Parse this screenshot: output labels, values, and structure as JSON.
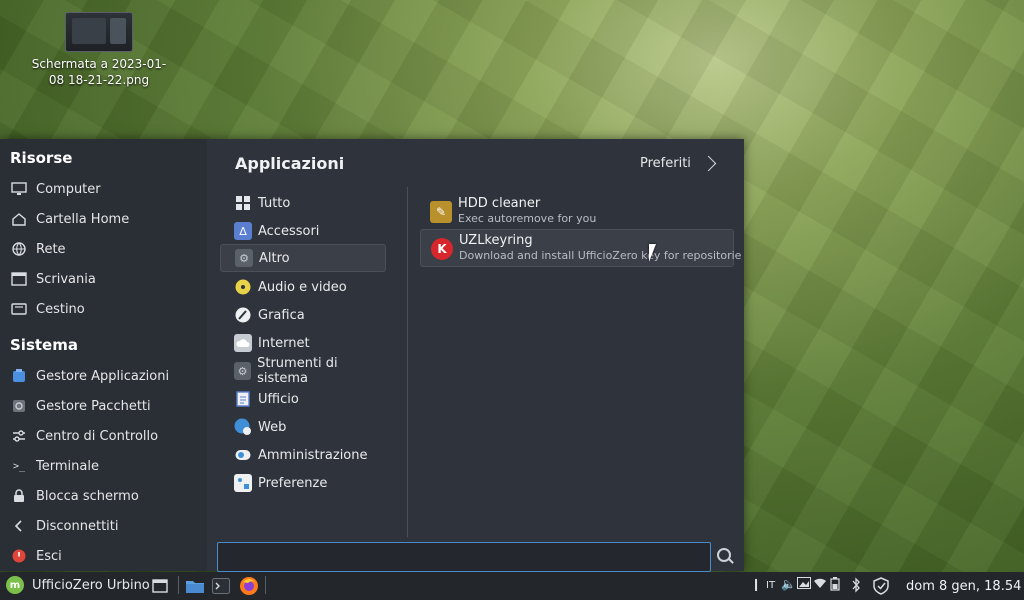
{
  "desktop": {
    "file_label": "Schermata a 2023-01-\n08 18-21-22.png"
  },
  "menu": {
    "resources_title": "Risorse",
    "resources": [
      {
        "label": "Computer",
        "icon": "monitor-icon"
      },
      {
        "label": "Cartella Home",
        "icon": "home-icon"
      },
      {
        "label": "Rete",
        "icon": "network-icon"
      },
      {
        "label": "Scrivania",
        "icon": "desktop-icon"
      },
      {
        "label": "Cestino",
        "icon": "trash-icon"
      }
    ],
    "system_title": "Sistema",
    "system": [
      {
        "label": "Gestore Applicazioni",
        "icon": "software-manager-icon"
      },
      {
        "label": "Gestore Pacchetti",
        "icon": "package-icon"
      },
      {
        "label": "Centro di Controllo",
        "icon": "sliders-icon"
      },
      {
        "label": "Terminale",
        "icon": "terminal-icon"
      },
      {
        "label": "Blocca schermo",
        "icon": "lock-icon"
      },
      {
        "label": "Disconnettiti",
        "icon": "chevron-left-icon"
      },
      {
        "label": "Esci",
        "icon": "power-icon"
      }
    ],
    "apps_title": "Applicazioni",
    "favorites_label": "Preferiti",
    "categories": [
      {
        "label": "Tutto",
        "icon": "grid-icon"
      },
      {
        "label": "Accessori",
        "icon": "accessories-icon"
      },
      {
        "label": "Altro",
        "icon": "gear-icon"
      },
      {
        "label": "Audio e video",
        "icon": "disc-icon"
      },
      {
        "label": "Grafica",
        "icon": "paint-icon"
      },
      {
        "label": "Internet",
        "icon": "cloud-icon"
      },
      {
        "label": "Strumenti di sistema",
        "icon": "gear-icon"
      },
      {
        "label": "Ufficio",
        "icon": "document-icon"
      },
      {
        "label": "Web",
        "icon": "globe-icon"
      },
      {
        "label": "Amministrazione",
        "icon": "toggle-icon"
      },
      {
        "label": "Preferenze",
        "icon": "preferences-icon"
      }
    ],
    "selected_category": "Altro",
    "apps": [
      {
        "name": "HDD cleaner",
        "desc": "Exec autoremove for you",
        "icon": "hdd-cleaner-icon"
      },
      {
        "name": "UZLkeyring",
        "desc": "Download and install UfficioZero key for repositorie",
        "icon": "keyring-icon",
        "icon_letter": "K"
      }
    ],
    "search": {
      "value": "",
      "placeholder": ""
    }
  },
  "panel": {
    "start_label": "UfficioZero Urbino",
    "tray_lang": "IT",
    "clock": "dom  8 gen, 18.54"
  },
  "colors": {
    "accent": "#4b8cc8",
    "mint_green": "#7cc04c",
    "keyring_red": "#d8262d"
  }
}
